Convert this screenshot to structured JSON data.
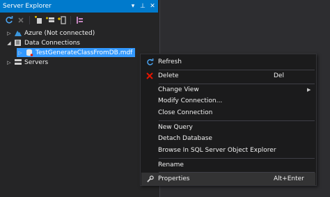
{
  "panel": {
    "title": "Server Explorer",
    "title_buttons": [
      "▾",
      "⊥",
      "✕"
    ]
  },
  "tree": {
    "azure": "Azure (Not connected)",
    "data_connections": "Data Connections",
    "db_file": "TestGenerateClassFromDB.mdf",
    "servers": "Servers"
  },
  "menu": {
    "refresh": "Refresh",
    "delete": "Delete",
    "delete_shortcut": "Del",
    "change_view": "Change View",
    "modify_connection": "Modify Connection...",
    "close_connection": "Close Connection",
    "new_query": "New Query",
    "detach_database": "Detach Database",
    "browse_sql": "Browse In SQL Server Object Explorer",
    "rename": "Rename",
    "properties": "Properties",
    "properties_shortcut": "Alt+Enter"
  },
  "colors": {
    "accent": "#007acc",
    "selection": "#3399ff",
    "delete_icon": "#e51400"
  }
}
